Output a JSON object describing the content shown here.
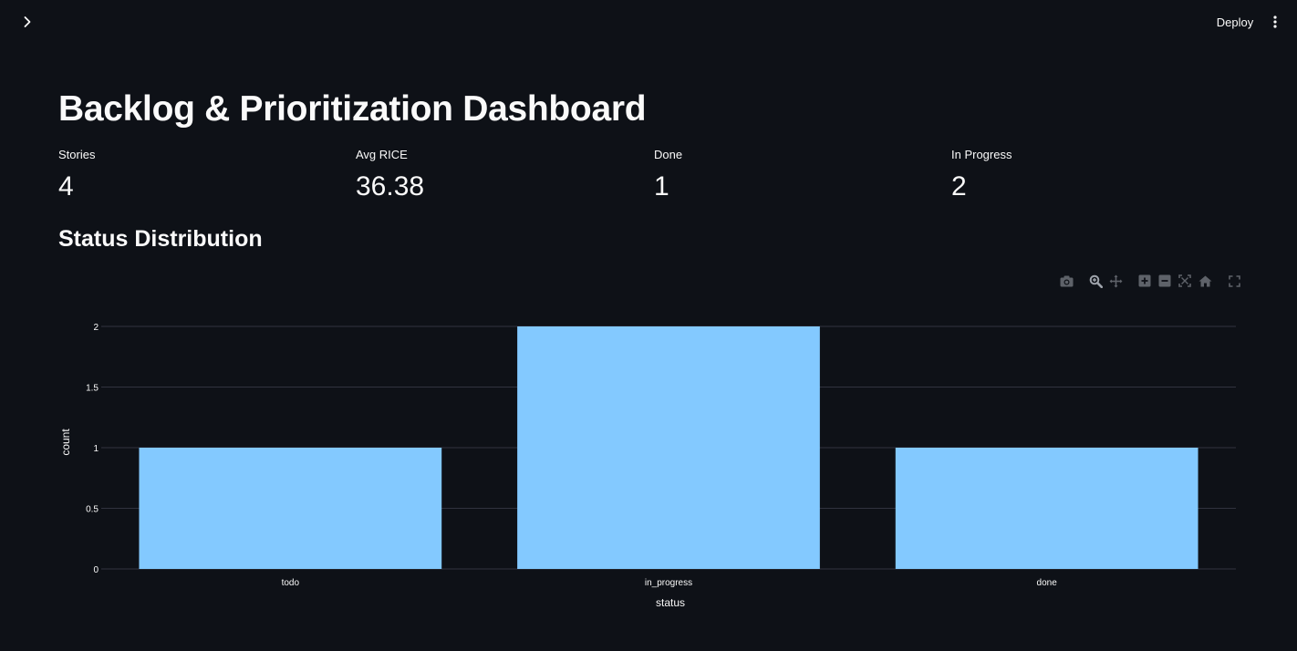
{
  "header": {
    "deploy_label": "Deploy"
  },
  "page": {
    "title": "Backlog & Prioritization Dashboard"
  },
  "metrics": [
    {
      "label": "Stories",
      "value": "4"
    },
    {
      "label": "Avg RICE",
      "value": "36.38"
    },
    {
      "label": "Done",
      "value": "1"
    },
    {
      "label": "In Progress",
      "value": "2"
    }
  ],
  "section": {
    "title": "Status Distribution"
  },
  "colors": {
    "background": "#0e1117",
    "bar": "#83c9ff",
    "grid": "#31333f",
    "text": "#fafafa"
  },
  "modebar_icons": [
    "camera-icon",
    "zoom-icon",
    "pan-icon",
    "zoom-in-icon",
    "zoom-out-icon",
    "autoscale-icon",
    "reset-axes-icon",
    "fullscreen-icon"
  ],
  "chart_data": {
    "type": "bar",
    "categories": [
      "todo",
      "in_progress",
      "done"
    ],
    "values": [
      1,
      2,
      1
    ],
    "xlabel": "status",
    "ylabel": "count",
    "ylim": [
      0,
      2
    ],
    "yticks": [
      0,
      0.5,
      1,
      1.5,
      2
    ],
    "ytick_labels": [
      "0",
      "0.5",
      "1",
      "1.5",
      "2"
    ],
    "grid": true
  }
}
